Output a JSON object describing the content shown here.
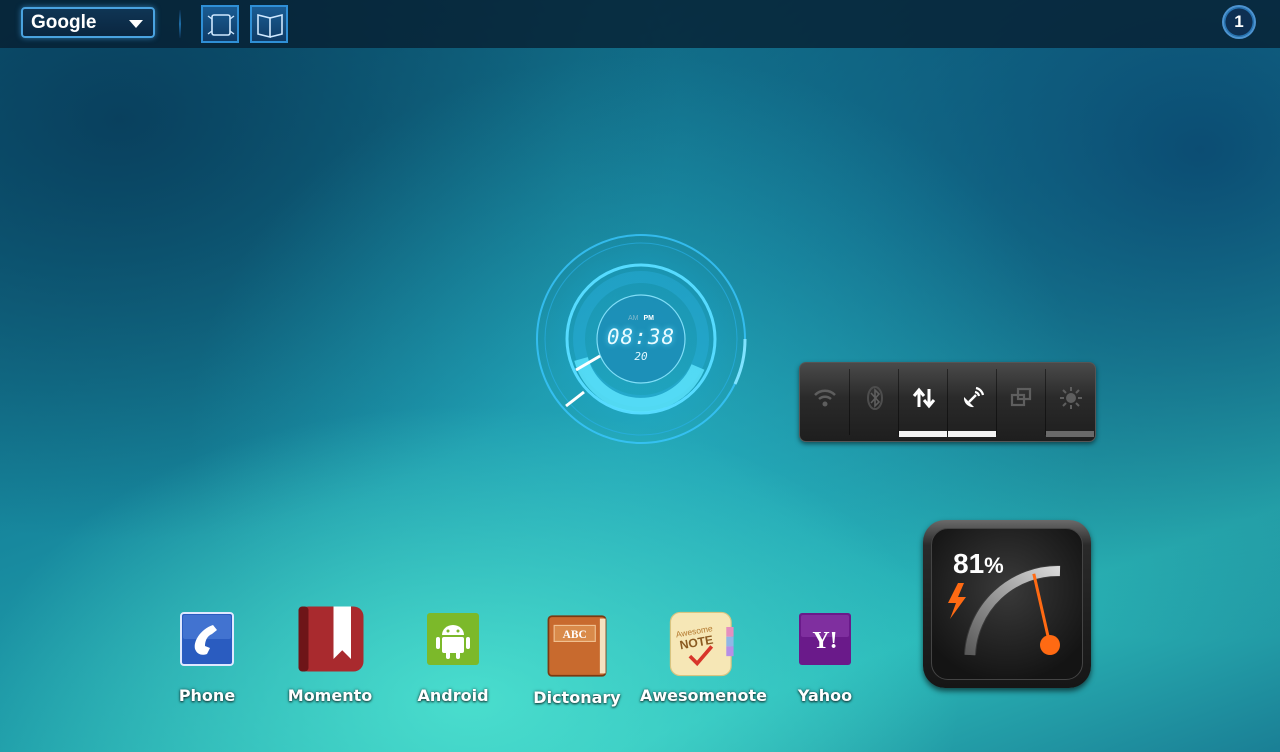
{
  "topbar": {
    "search_engine": "Google",
    "screen_badge": "1"
  },
  "clock": {
    "am": "AM",
    "pm": "PM",
    "time": "08:38",
    "seconds": "20"
  },
  "toggles": {
    "items": [
      {
        "icon": "wifi-icon",
        "active": false
      },
      {
        "icon": "bluetooth-icon",
        "active": false
      },
      {
        "icon": "data-sync-icon",
        "active": true
      },
      {
        "icon": "gps-icon",
        "active": true
      },
      {
        "icon": "rotate-icon",
        "active": false
      },
      {
        "icon": "brightness-icon",
        "active": false
      }
    ]
  },
  "battery": {
    "value": "81",
    "unit": "%",
    "level": 0.81,
    "accent_color": "#ff6a13"
  },
  "dock": {
    "apps": [
      {
        "label": "Phone",
        "icon": "phone-icon"
      },
      {
        "label": "Momento",
        "icon": "bookmark-icon"
      },
      {
        "label": "Android",
        "icon": "android-icon"
      },
      {
        "label": "Dictonary",
        "icon": "dictionary-icon"
      },
      {
        "label": "Awesomenote",
        "icon": "note-icon"
      },
      {
        "label": "Yahoo",
        "icon": "yahoo-icon"
      }
    ],
    "dictionary_icon_text": "ABC",
    "note_icon_text_1": "Awesome",
    "note_icon_text_2": "NOTE",
    "yahoo_icon_text": "Y!"
  }
}
